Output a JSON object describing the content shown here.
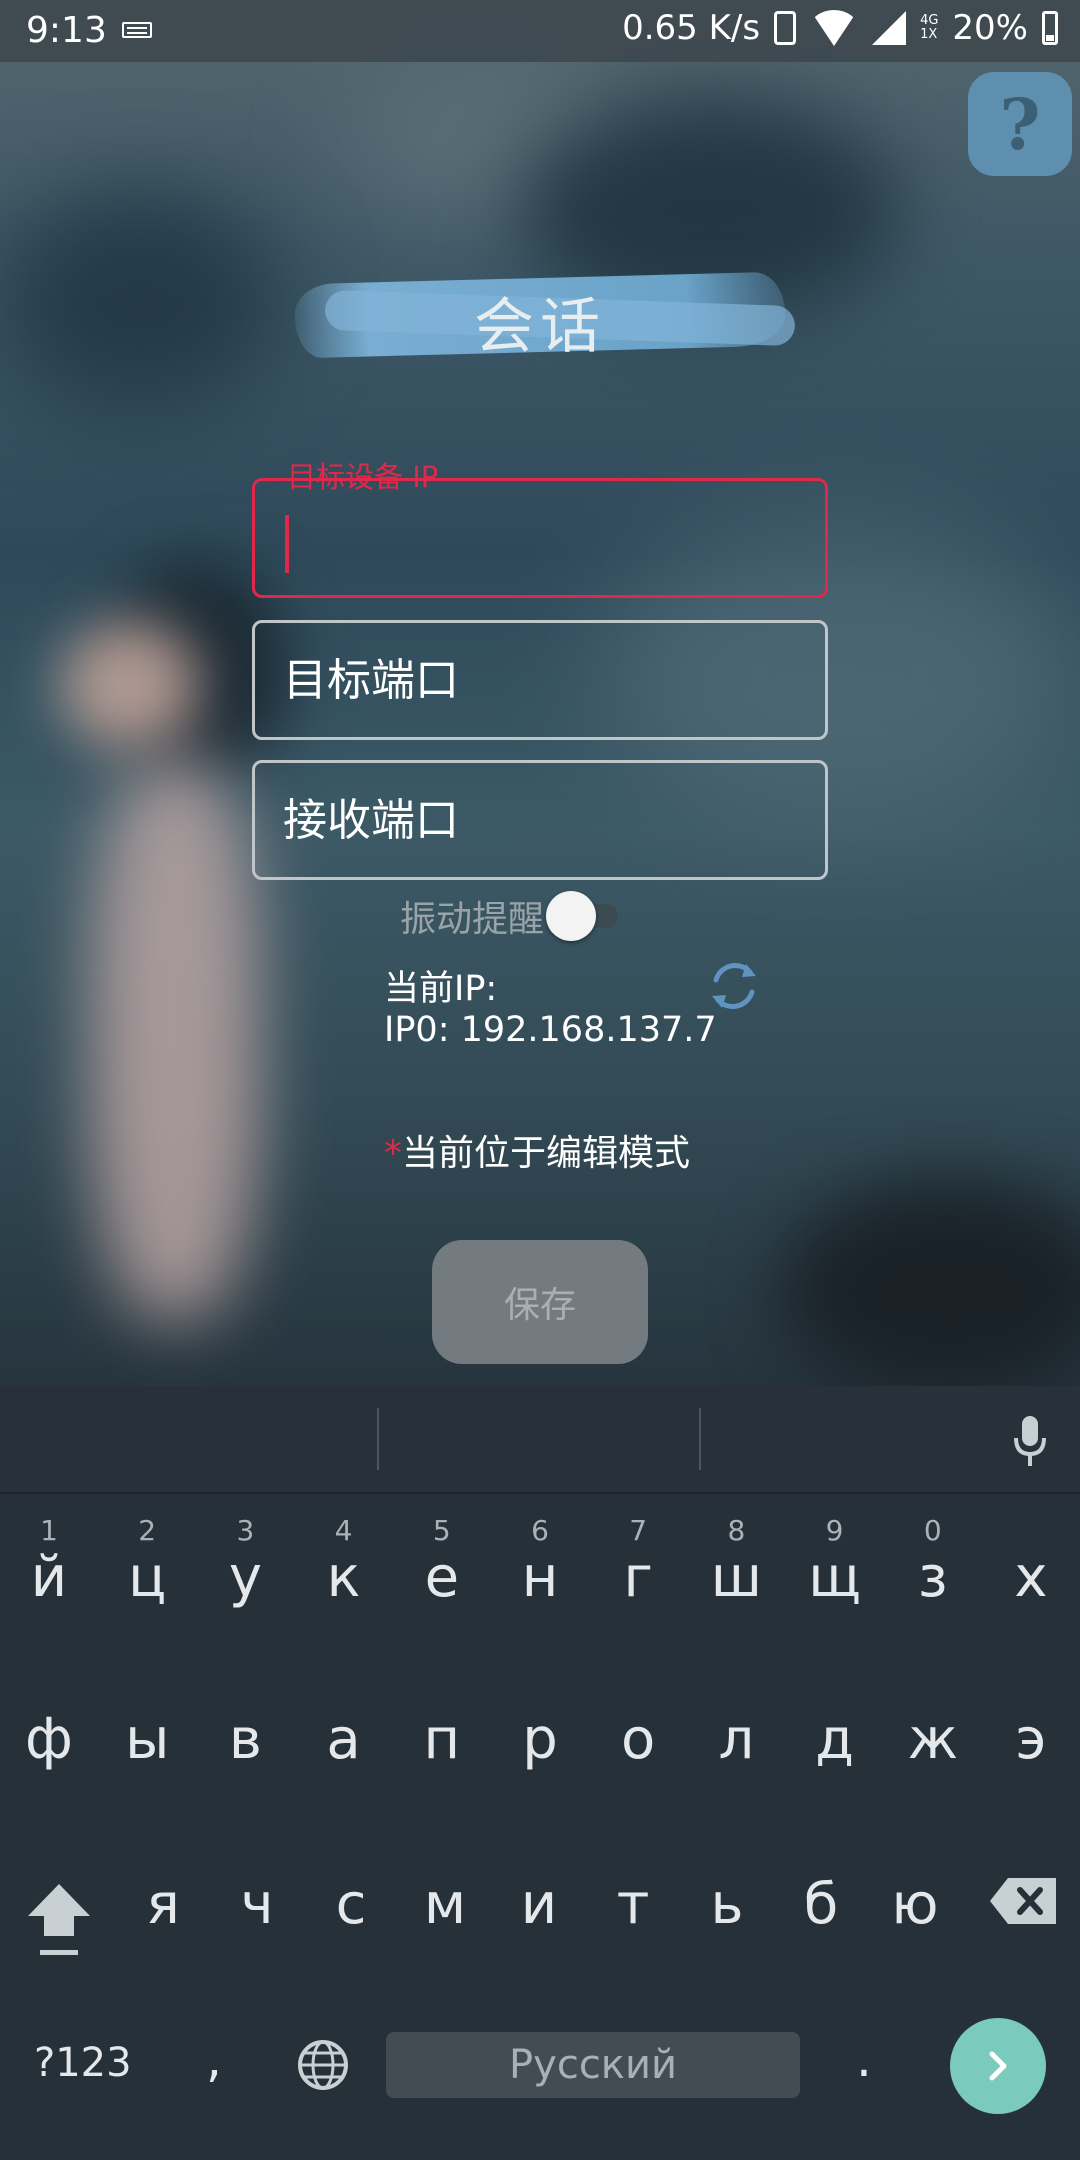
{
  "status_bar": {
    "time": "9:13",
    "net_speed": "0.65 K/s",
    "network_type_top": "4G",
    "network_type_bottom": "1X",
    "battery": "20%",
    "icons": [
      "keyboard-icon",
      "vibrate-icon",
      "wifi-icon",
      "signal-icon",
      "battery-icon"
    ]
  },
  "help_button": {
    "label": "?"
  },
  "title": "会话",
  "form": {
    "ip_field": {
      "label": "目标设备 IP",
      "value": ""
    },
    "target_port_field": {
      "placeholder": "目标端口",
      "value": ""
    },
    "receive_port_field": {
      "placeholder": "接收端口",
      "value": ""
    },
    "vibration_toggle": {
      "label": "振动提醒",
      "checked": false
    }
  },
  "ip_info": {
    "title": "当前IP:",
    "value": "IP0: 192.168.137.7"
  },
  "edit_mode": {
    "star": "*",
    "text": "当前位于编辑模式"
  },
  "save_button": {
    "label": "保存"
  },
  "keyboard": {
    "row1": [
      {
        "key": "й",
        "hint": "1"
      },
      {
        "key": "ц",
        "hint": "2"
      },
      {
        "key": "у",
        "hint": "3"
      },
      {
        "key": "к",
        "hint": "4"
      },
      {
        "key": "е",
        "hint": "5"
      },
      {
        "key": "н",
        "hint": "6"
      },
      {
        "key": "г",
        "hint": "7"
      },
      {
        "key": "ш",
        "hint": "8"
      },
      {
        "key": "щ",
        "hint": "9"
      },
      {
        "key": "з",
        "hint": "0"
      },
      {
        "key": "х",
        "hint": ""
      }
    ],
    "row2": [
      "ф",
      "ы",
      "в",
      "а",
      "п",
      "р",
      "о",
      "л",
      "д",
      "ж",
      "э"
    ],
    "row3": [
      "я",
      "ч",
      "с",
      "м",
      "и",
      "т",
      "ь",
      "б",
      "ю"
    ],
    "symbols_key": "?123",
    "comma_key": ",",
    "space_label": "Русский",
    "period_key": "."
  },
  "colors": {
    "accent_error": "#e0284a",
    "enter_key": "#7bcbbd",
    "help_button": "#5e8fae",
    "keyboard_bg": "#263038"
  }
}
